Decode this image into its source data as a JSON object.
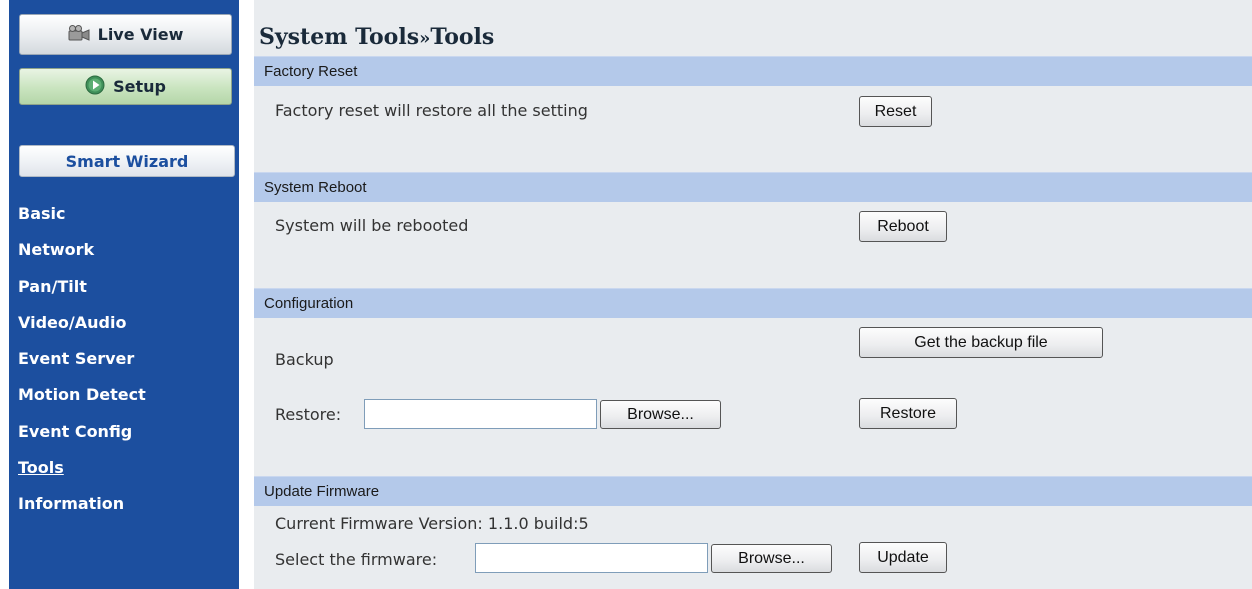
{
  "sidebar": {
    "live_view_label": "Live View",
    "setup_label": "Setup",
    "smart_wizard_label": "Smart Wizard",
    "nav": [
      {
        "label": "Basic"
      },
      {
        "label": "Network"
      },
      {
        "label": "Pan/Tilt"
      },
      {
        "label": "Video/Audio"
      },
      {
        "label": "Event Server"
      },
      {
        "label": "Motion Detect"
      },
      {
        "label": "Event Config"
      },
      {
        "label": "Tools",
        "active": true
      },
      {
        "label": "Information"
      }
    ]
  },
  "breadcrumb": {
    "parent": "System Tools",
    "separator": "»",
    "current": "Tools"
  },
  "sections": {
    "factory_reset": {
      "title": "Factory Reset",
      "description": "Factory reset will restore all the setting",
      "button_label": "Reset"
    },
    "system_reboot": {
      "title": "System Reboot",
      "description": "System will be rebooted",
      "button_label": "Reboot"
    },
    "configuration": {
      "title": "Configuration",
      "backup_label": "Backup",
      "backup_button_label": "Get the backup file",
      "restore_label": "Restore:",
      "restore_file_value": "",
      "browse_label": "Browse...",
      "restore_button_label": "Restore"
    },
    "update_firmware": {
      "title": "Update Firmware",
      "current_version_label": "Current Firmware Version:",
      "current_version_value": "1.1.0 build:5",
      "select_label": "Select the firmware:",
      "firmware_file_value": "",
      "browse_label": "Browse...",
      "update_button_label": "Update"
    }
  },
  "colors": {
    "sidebar_bg": "#1c4f9f",
    "main_bg": "#e9ecef",
    "section_header_bg": "#b4c9ea"
  }
}
